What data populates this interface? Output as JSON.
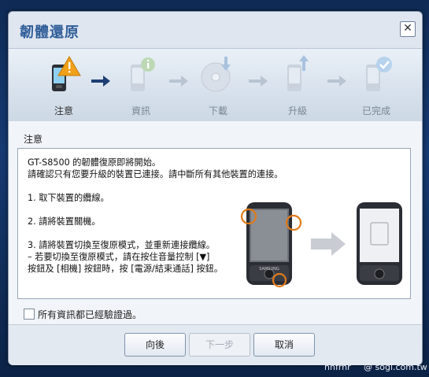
{
  "dialog": {
    "title": "韌體還原",
    "close_glyph": "✕"
  },
  "steps": [
    {
      "label": "注意",
      "icon": "phone-warning-icon",
      "active": true
    },
    {
      "label": "資訊",
      "icon": "phone-info-icon",
      "active": false
    },
    {
      "label": "下載",
      "icon": "disc-download-icon",
      "active": false
    },
    {
      "label": "升級",
      "icon": "phone-upgrade-icon",
      "active": false
    },
    {
      "label": "已完成",
      "icon": "phone-check-icon",
      "active": false
    }
  ],
  "section": {
    "title": "注意"
  },
  "message": {
    "line1": "GT-S8500 的韌體復原即將開始。",
    "line2": "請確認只有您要升級的裝置已連接。請中斷所有其他裝置的連接。",
    "step1": "1. 取下裝置的纜線。",
    "step2": "2. 請將裝置關機。",
    "step3a": "3. 請將裝置切換至復原模式，並重新連接纜線。",
    "step3b": "– 若要切換至復原模式，請在按住音量控制 [▼]",
    "step3c": "按鈕及 [相機] 按鈕時，按 [電源/結束通話] 按鈕。"
  },
  "illustration": {
    "brand": "SAMSUNG"
  },
  "checkbox": {
    "label": "所有資訊都已經驗證過。",
    "checked": false
  },
  "buttons": {
    "back": "向後",
    "next": "下一步",
    "cancel": "取消"
  },
  "watermark": {
    "left": "nnfrnr",
    "right": "@ sogi.com.tw"
  },
  "colors": {
    "title": "#2f5d98",
    "active_arrow": "#1d3f73",
    "inactive": "#b9c4d2",
    "highlight_ring": "#e07a1a"
  }
}
